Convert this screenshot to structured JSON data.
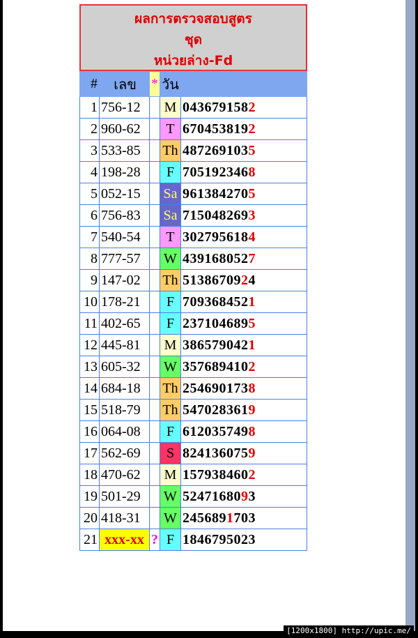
{
  "title": {
    "line1": "ผลการตรวจสอบสูตร",
    "line2": "ชุด",
    "line3": "หน่วยล่าง-Fd"
  },
  "headers": {
    "no": "#",
    "code": "เลข",
    "star": "*",
    "day": "วัน"
  },
  "day_colors": {
    "M": "#ffffcc",
    "T": "#ff99ff",
    "W": "#66ff66",
    "Th": "#ffcc66",
    "F": "#66ffff",
    "Sa": "#6666cc",
    "S": "#ff3366"
  },
  "rows": [
    {
      "no": "1",
      "code": "756-12",
      "star": "",
      "day": "M",
      "pre": "043679158",
      "hit": "2",
      "post": ""
    },
    {
      "no": "2",
      "code": "960-62",
      "star": "",
      "day": "T",
      "pre": "670453819",
      "hit": "2",
      "post": ""
    },
    {
      "no": "3",
      "code": "533-85",
      "star": "",
      "day": "Th",
      "pre": "487269103",
      "hit": "5",
      "post": ""
    },
    {
      "no": "4",
      "code": "198-28",
      "star": "",
      "day": "F",
      "pre": "705192346",
      "hit": "8",
      "post": ""
    },
    {
      "no": "5",
      "code": "052-15",
      "star": "",
      "day": "Sa",
      "pre": "961384270",
      "hit": "5",
      "post": ""
    },
    {
      "no": "6",
      "code": "756-83",
      "star": "",
      "day": "Sa",
      "pre": "715048269",
      "hit": "3",
      "post": ""
    },
    {
      "no": "7",
      "code": "540-54",
      "star": "",
      "day": "T",
      "pre": "302795618",
      "hit": "4",
      "post": ""
    },
    {
      "no": "8",
      "code": "777-57",
      "star": "",
      "day": "W",
      "pre": "439168052",
      "hit": "7",
      "post": ""
    },
    {
      "no": "9",
      "code": "147-02",
      "star": "",
      "day": "Th",
      "pre": "51386709",
      "hit": "2",
      "post": "4"
    },
    {
      "no": "10",
      "code": "178-21",
      "star": "",
      "day": "F",
      "pre": "709368452",
      "hit": "1",
      "post": ""
    },
    {
      "no": "11",
      "code": "402-65",
      "star": "",
      "day": "F",
      "pre": "237104689",
      "hit": "5",
      "post": ""
    },
    {
      "no": "12",
      "code": "445-81",
      "star": "",
      "day": "M",
      "pre": "386579042",
      "hit": "1",
      "post": ""
    },
    {
      "no": "13",
      "code": "605-32",
      "star": "",
      "day": "W",
      "pre": "357689410",
      "hit": "2",
      "post": ""
    },
    {
      "no": "14",
      "code": "684-18",
      "star": "",
      "day": "Th",
      "pre": "254690173",
      "hit": "8",
      "post": ""
    },
    {
      "no": "15",
      "code": "518-79",
      "star": "",
      "day": "Th",
      "pre": "547028361",
      "hit": "9",
      "post": ""
    },
    {
      "no": "16",
      "code": "064-08",
      "star": "",
      "day": "F",
      "pre": "612035749",
      "hit": "8",
      "post": ""
    },
    {
      "no": "17",
      "code": "562-69",
      "star": "",
      "day": "S",
      "pre": "824136075",
      "hit": "9",
      "post": ""
    },
    {
      "no": "18",
      "code": "470-62",
      "star": "",
      "day": "M",
      "pre": "157938460",
      "hit": "2",
      "post": ""
    },
    {
      "no": "19",
      "code": "501-29",
      "star": "",
      "day": "W",
      "pre": "52471680",
      "hit": "9",
      "post": "3"
    },
    {
      "no": "20",
      "code": "418-31",
      "star": "",
      "day": "W",
      "pre": "245689",
      "hit": "1",
      "post": "703"
    },
    {
      "no": "21",
      "code": "xxx-xx",
      "star": "?",
      "day": "F",
      "pre": "1846795023",
      "hit": "",
      "post": "",
      "pending": true
    }
  ],
  "footer": "[1200x1800] http://upic.me/"
}
